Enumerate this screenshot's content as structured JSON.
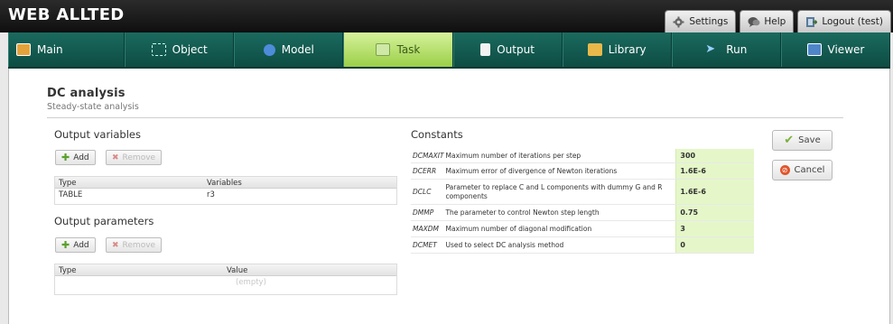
{
  "app": {
    "title": "WEB ALLTED"
  },
  "top_tabs": [
    {
      "label": "Settings",
      "icon": "gear-icon"
    },
    {
      "label": "Help",
      "icon": "help-icon"
    },
    {
      "label": "Logout (test)",
      "icon": "logout-icon"
    }
  ],
  "nav": [
    {
      "label": "Main",
      "icon": "main-icon",
      "active": false
    },
    {
      "label": "Object",
      "icon": "object-icon",
      "active": false
    },
    {
      "label": "Model",
      "icon": "model-icon",
      "active": false
    },
    {
      "label": "Task",
      "icon": "task-icon",
      "active": true
    },
    {
      "label": "Output",
      "icon": "output-icon",
      "active": false
    },
    {
      "label": "Library",
      "icon": "library-icon",
      "active": false
    },
    {
      "label": "Run",
      "icon": "run-icon",
      "active": false
    },
    {
      "label": "Viewer",
      "icon": "viewer-icon",
      "active": false
    }
  ],
  "section": {
    "title": "DC analysis",
    "subtitle": "Steady-state analysis"
  },
  "output_variables": {
    "heading": "Output variables",
    "add_label": "Add",
    "remove_label": "Remove",
    "columns": [
      "Type",
      "Variables"
    ],
    "rows": [
      [
        "TABLE",
        "r3"
      ]
    ]
  },
  "output_parameters": {
    "heading": "Output parameters",
    "add_label": "Add",
    "remove_label": "Remove",
    "columns": [
      "Type",
      "Value"
    ],
    "empty_text": "(empty)"
  },
  "constants": {
    "heading": "Constants",
    "rows": [
      {
        "name": "DCMAXIT",
        "desc": "Maximum number of iterations per step",
        "value": "300"
      },
      {
        "name": "DCERR",
        "desc": "Maximum error of divergence of Newton iterations",
        "value": "1.6E-6"
      },
      {
        "name": "DCLC",
        "desc": "Parameter to replace C and L components with dummy G and R components",
        "value": "1.6E-6"
      },
      {
        "name": "DMMP",
        "desc": "The parameter to control Newton step length",
        "value": "0.75"
      },
      {
        "name": "MAXDM",
        "desc": "Maximum number of diagonal modification",
        "value": "3"
      },
      {
        "name": "DCMET",
        "desc": "Used to select DC analysis method",
        "value": "0"
      }
    ]
  },
  "actions": {
    "save_label": "Save",
    "cancel_label": "Cancel"
  },
  "colors": {
    "nav_bg": "#14584f",
    "nav_active": "#b8e36e",
    "value_bg": "#e5f7c9"
  }
}
